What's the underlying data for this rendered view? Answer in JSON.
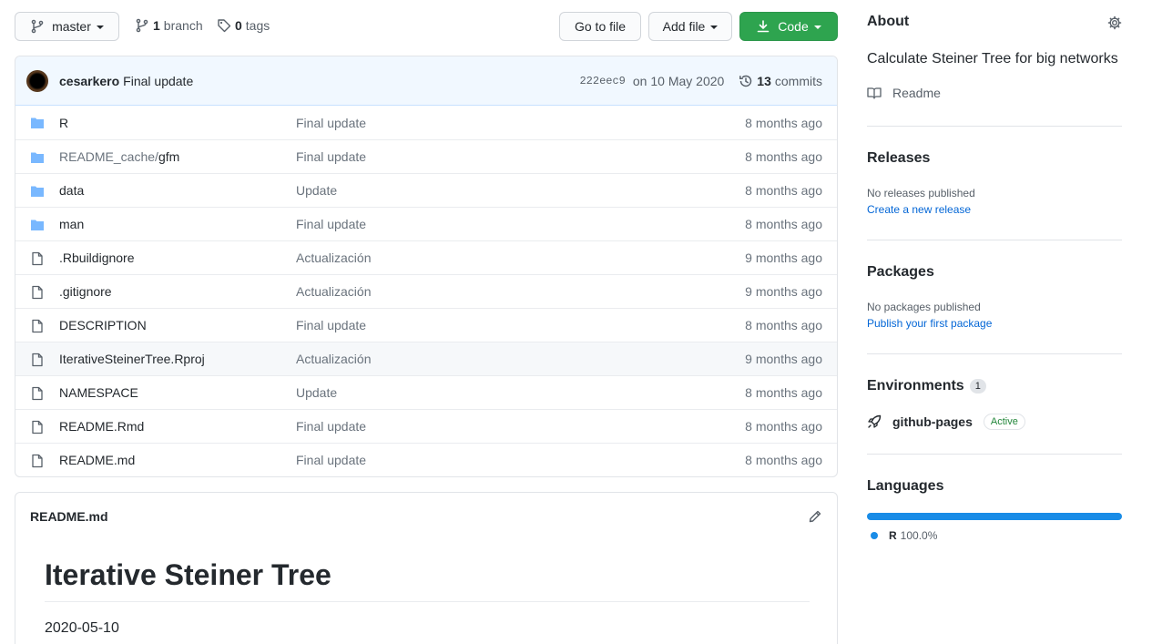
{
  "toolbar": {
    "branch_button": "master",
    "branch_count": "1",
    "branch_label": "branch",
    "tag_count": "0",
    "tag_label": "tags",
    "go_to_file": "Go to file",
    "add_file": "Add file",
    "code": "Code"
  },
  "commit": {
    "author": "cesarkero",
    "message": "Final update",
    "sha": "222eec9",
    "date": "on 10 May 2020",
    "commit_count": "13",
    "commit_label": "commits"
  },
  "files": [
    {
      "type": "folder",
      "name_muted": "",
      "name": "R",
      "message": "Final update",
      "age": "8 months ago"
    },
    {
      "type": "folder",
      "name_muted": "README_cache/",
      "name": "gfm",
      "message": "Final update",
      "age": "8 months ago"
    },
    {
      "type": "folder",
      "name_muted": "",
      "name": "data",
      "message": "Update",
      "age": "8 months ago"
    },
    {
      "type": "folder",
      "name_muted": "",
      "name": "man",
      "message": "Final update",
      "age": "8 months ago"
    },
    {
      "type": "file",
      "name_muted": "",
      "name": ".Rbuildignore",
      "message": "Actualización",
      "age": "9 months ago"
    },
    {
      "type": "file",
      "name_muted": "",
      "name": ".gitignore",
      "message": "Actualización",
      "age": "9 months ago"
    },
    {
      "type": "file",
      "name_muted": "",
      "name": "DESCRIPTION",
      "message": "Final update",
      "age": "8 months ago"
    },
    {
      "type": "file",
      "name_muted": "",
      "name": "IterativeSteinerTree.Rproj",
      "message": "Actualización",
      "age": "9 months ago"
    },
    {
      "type": "file",
      "name_muted": "",
      "name": "NAMESPACE",
      "message": "Update",
      "age": "8 months ago"
    },
    {
      "type": "file",
      "name_muted": "",
      "name": "README.Rmd",
      "message": "Final update",
      "age": "8 months ago"
    },
    {
      "type": "file",
      "name_muted": "",
      "name": "README.md",
      "message": "Final update",
      "age": "8 months ago"
    }
  ],
  "readme": {
    "filename": "README.md",
    "title": "Iterative Steiner Tree",
    "date": "2020-05-10"
  },
  "about": {
    "heading": "About",
    "description": "Calculate Steiner Tree for big networks",
    "readme_link": "Readme"
  },
  "releases": {
    "heading": "Releases",
    "status": "No releases published",
    "link": "Create a new release"
  },
  "packages": {
    "heading": "Packages",
    "status": "No packages published",
    "link": "Publish your first package"
  },
  "environments": {
    "heading": "Environments",
    "count": "1",
    "name": "github-pages",
    "status": "Active"
  },
  "languages": {
    "heading": "Languages",
    "name": "R",
    "percent": "100.0%",
    "share": 1.0,
    "color": "#198ce7"
  },
  "colors": {
    "code_button": "#2ea44f",
    "folder_icon": "#79b8ff",
    "link": "#0366d6"
  }
}
